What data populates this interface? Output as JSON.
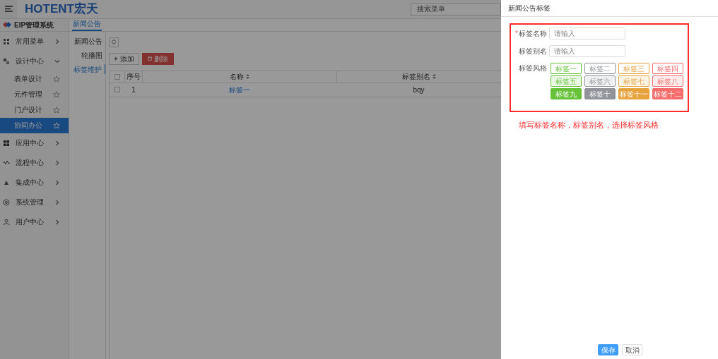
{
  "header": {
    "logo": "HOTENT宏天",
    "search": {
      "placeholder": "搜索菜单"
    }
  },
  "sidebar": {
    "system_title": "EIP管理系统",
    "items": [
      {
        "label": "常用菜单",
        "expanded": false
      },
      {
        "label": "设计中心",
        "expanded": true,
        "children": [
          {
            "label": "表单设计",
            "selected": false
          },
          {
            "label": "元件管理",
            "selected": false
          },
          {
            "label": "门户设计",
            "selected": false
          },
          {
            "label": "协同办公",
            "selected": true
          }
        ]
      },
      {
        "label": "应用中心",
        "expanded": false
      },
      {
        "label": "流程中心",
        "expanded": false
      },
      {
        "label": "集成中心",
        "expanded": false
      },
      {
        "label": "系统管理",
        "expanded": false
      },
      {
        "label": "用户中心",
        "expanded": false
      }
    ]
  },
  "tabs": [
    {
      "label": "新闻公告",
      "selected": true
    }
  ],
  "subnav": [
    {
      "label": "新闻公告",
      "selected": false
    },
    {
      "label": "轮播图",
      "selected": false
    },
    {
      "label": "标签维护",
      "selected": true
    }
  ],
  "toolbar": {
    "add": "+ 添加",
    "delete": "删除"
  },
  "table": {
    "header_checked": false,
    "columns": [
      "序号",
      "名称",
      "标签别名"
    ],
    "rows": [
      {
        "checked": false,
        "index": "1",
        "name": "标签一",
        "alias": "bqy"
      }
    ]
  },
  "drawer": {
    "title": "新闻公告标签",
    "fields": [
      {
        "marker": "*",
        "label": "标签名称",
        "placeholder": "请输入"
      },
      {
        "label": "标签别名",
        "placeholder": "请输入"
      }
    ],
    "style_label": "标签风格",
    "tags": [
      {
        "label": "标签一",
        "kind": "plain",
        "color": "#67c23a"
      },
      {
        "label": "标签二",
        "kind": "plain",
        "color": "#909399"
      },
      {
        "label": "标签三",
        "kind": "plain",
        "color": "#e6a23c"
      },
      {
        "label": "标签四",
        "kind": "plain",
        "color": "#f56c6c"
      },
      {
        "label": "标签五",
        "kind": "light",
        "color": "#67c23a"
      },
      {
        "label": "标签六",
        "kind": "light",
        "color": "#909399"
      },
      {
        "label": "标签七",
        "kind": "light",
        "color": "#e6a23c"
      },
      {
        "label": "标签八",
        "kind": "light",
        "color": "#f56c6c"
      },
      {
        "label": "标签九",
        "kind": "dark",
        "color": "#67c23a"
      },
      {
        "label": "标签十",
        "kind": "dark",
        "color": "#909399"
      },
      {
        "label": "标签十一",
        "kind": "dark",
        "color": "#e6a23c"
      },
      {
        "label": "标签十二",
        "kind": "dark",
        "color": "#f56c6c"
      }
    ],
    "annotation": "填写标签名称，标签别名，选择标签风格",
    "buttons": [
      {
        "label": "保存",
        "kind": "primary"
      },
      {
        "label": "取消",
        "kind": "default"
      }
    ]
  }
}
